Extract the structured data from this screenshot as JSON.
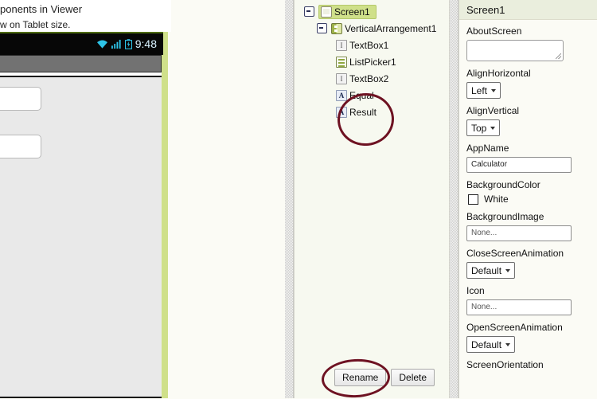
{
  "viewer": {
    "header_line1": "ponents in Viewer",
    "header_line2": "w on Tablet size.",
    "status_time": "9:48",
    "wifi_icon": "wifi-icon",
    "signal_icon": "signal-bars-icon",
    "battery_icon": "battery-icon",
    "textbox1_value": "",
    "textbox2_value": ""
  },
  "tree": {
    "nodes": [
      {
        "label": "Screen1",
        "icon": "screen-icon",
        "selected": true
      },
      {
        "label": "VerticalArrangement1",
        "icon": "vertical-arrangement-icon",
        "selected": false
      },
      {
        "label": "TextBox1",
        "icon": "textbox-icon",
        "selected": false
      },
      {
        "label": "ListPicker1",
        "icon": "listpicker-icon",
        "selected": false
      },
      {
        "label": "TextBox2",
        "icon": "textbox-icon",
        "selected": false
      },
      {
        "label": "Equal",
        "icon": "label-icon",
        "selected": false
      },
      {
        "label": "Result",
        "icon": "label-icon",
        "selected": false
      }
    ],
    "rename_label": "Rename",
    "delete_label": "Delete",
    "annotation_color": "#6e1222"
  },
  "properties": {
    "title": "Screen1",
    "items": [
      {
        "name": "AboutScreen",
        "type": "textarea",
        "value": ""
      },
      {
        "name": "AlignHorizontal",
        "type": "select",
        "value": "Left"
      },
      {
        "name": "AlignVertical",
        "type": "select",
        "value": "Top"
      },
      {
        "name": "AppName",
        "type": "input",
        "value": "Calculator"
      },
      {
        "name": "BackgroundColor",
        "type": "color",
        "value": "White",
        "swatch": "#ffffff"
      },
      {
        "name": "BackgroundImage",
        "type": "input",
        "value": "None..."
      },
      {
        "name": "CloseScreenAnimation",
        "type": "select",
        "value": "Default"
      },
      {
        "name": "Icon",
        "type": "input",
        "value": "None..."
      },
      {
        "name": "OpenScreenAnimation",
        "type": "select",
        "value": "Default"
      },
      {
        "name": "ScreenOrientation",
        "type": "label-only",
        "value": ""
      }
    ]
  }
}
